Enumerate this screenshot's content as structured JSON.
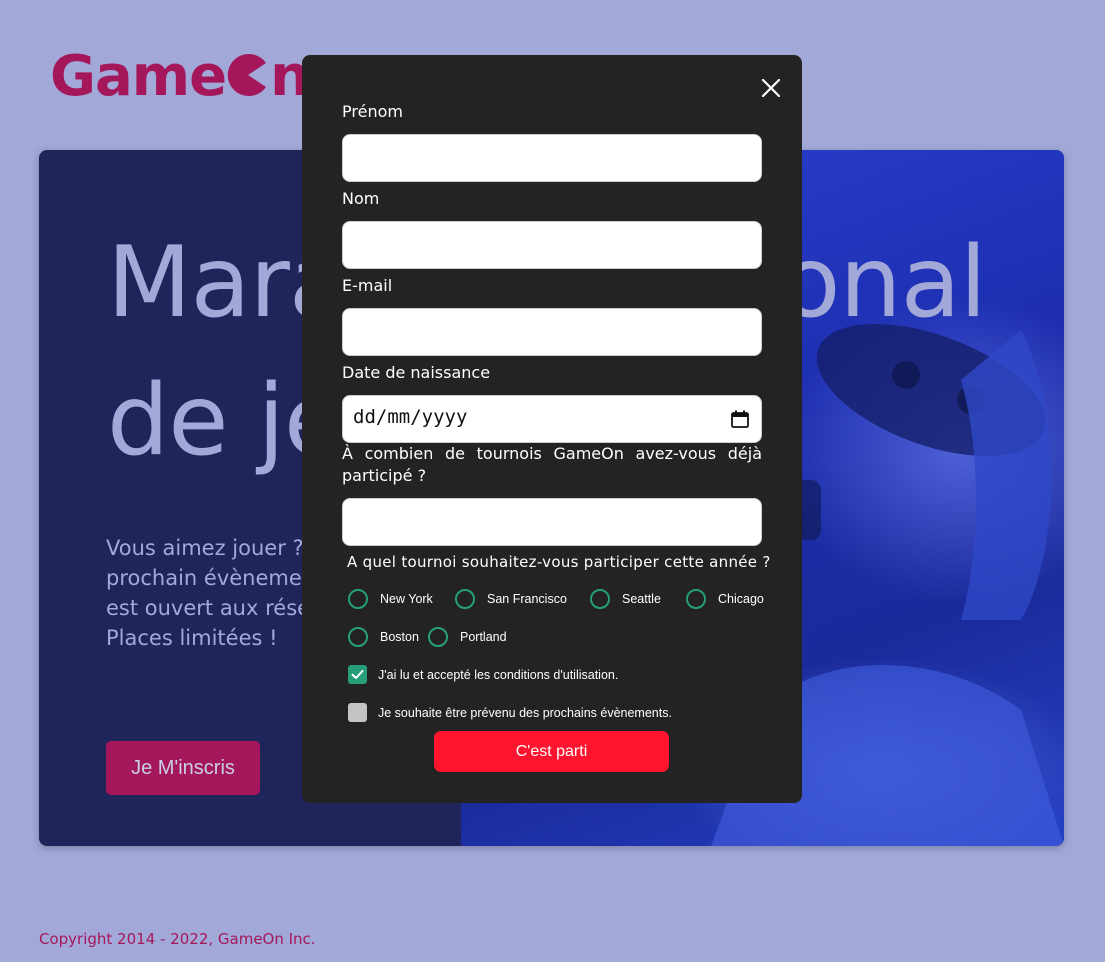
{
  "brand": {
    "logo_prefix": "Game",
    "logo_suffix": "n",
    "color": "#a4185b"
  },
  "hero": {
    "title_line1": "Marathon national",
    "title_line2": "de jeux vidéos",
    "text": "Vous aimez jouer ? Notre prochain évènement gaming est ouvert aux réservations... Places limitées !",
    "cta_label": "Je M'inscris",
    "background": "#1f245a"
  },
  "modal": {
    "close_icon": "close-icon",
    "fields": [
      {
        "label": "Prénom",
        "value": ""
      },
      {
        "label": "Nom",
        "value": ""
      },
      {
        "label": "E-mail",
        "value": ""
      },
      {
        "label": "Date de naissance",
        "value": "dd/mm/yyyy"
      },
      {
        "label": "À combien de tournois GameOn avez-vous déjà participé ?",
        "value": ""
      }
    ],
    "tournament_question": "A quel tournoi souhaitez-vous participer cette année ?",
    "locations": [
      "New York",
      "San Francisco",
      "Seattle",
      "Chicago",
      "Boston",
      "Portland"
    ],
    "checkbox_terms": {
      "label": "J'ai lu et accepté les conditions d'utilisation.",
      "checked": true
    },
    "checkbox_news": {
      "label": "Je souhaite être prévenu des prochains évènements.",
      "checked": false
    },
    "submit_label": "C'est parti",
    "accent": "#279e7a",
    "submit_color": "#fe142f"
  },
  "footer": {
    "copyright": "Copyright 2014 - 2022, GameOn Inc."
  }
}
